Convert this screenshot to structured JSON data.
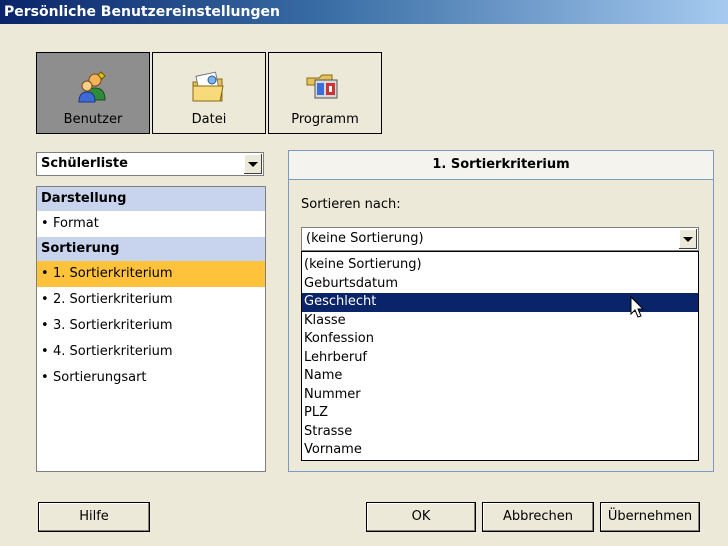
{
  "window": {
    "title": "Persönliche Benutzereinstellungen"
  },
  "toolbar": {
    "buttons": [
      {
        "label": "Benutzer",
        "icon": "user-settings-icon",
        "active": true
      },
      {
        "label": "Datei",
        "icon": "folder-icon",
        "active": false
      },
      {
        "label": "Programm",
        "icon": "program-icon",
        "active": false
      }
    ]
  },
  "left": {
    "combo_value": "Schülerliste",
    "groups": [
      {
        "title": "Darstellung",
        "items": [
          "Format"
        ]
      },
      {
        "title": "Sortierung",
        "items": [
          "1. Sortierkriterium",
          "2. Sortierkriterium",
          "3. Sortierkriterium",
          "4. Sortierkriterium",
          "Sortierungsart"
        ]
      }
    ],
    "selected_item": "1. Sortierkriterium"
  },
  "panel": {
    "title": "1. Sortierkriterium",
    "sort_label": "Sortieren nach:",
    "select_value": "(keine Sortierung)",
    "options": [
      "(keine Sortierung)",
      "Geburtsdatum",
      "Geschlecht",
      "Klasse",
      "Konfession",
      "Lehrberuf",
      "Name",
      "Nummer",
      "PLZ",
      "Strasse",
      "Vorname"
    ],
    "highlighted_option": "Geschlecht"
  },
  "buttons": {
    "help": "Hilfe",
    "ok": "OK",
    "cancel": "Abbrechen",
    "apply": "Übernehmen"
  },
  "colors": {
    "selected_item": "#ffc23a",
    "group_header": "#c8d3ee",
    "highlight": "#0a246a",
    "active_tab": "#8e8e8e"
  }
}
